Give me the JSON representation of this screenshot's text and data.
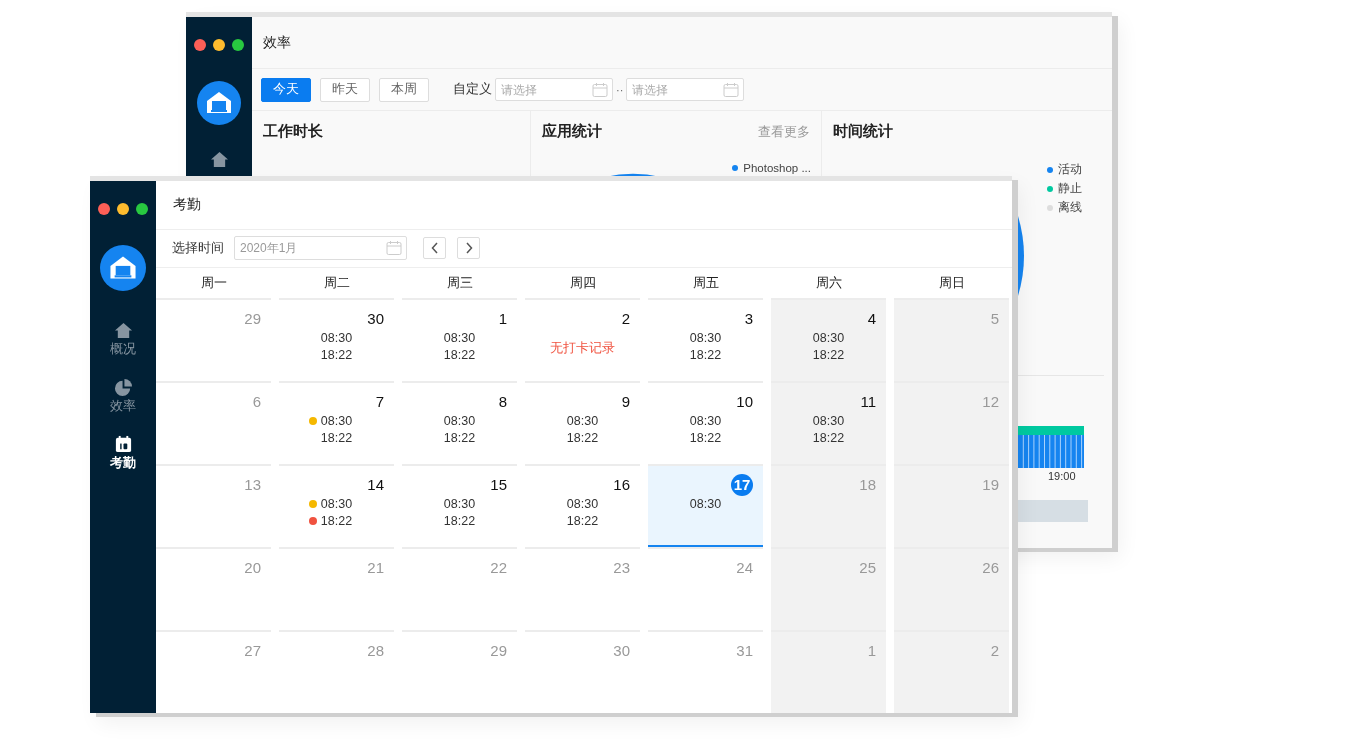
{
  "back_window": {
    "title": "效率",
    "range_buttons": [
      {
        "label": "今天",
        "selected": true
      },
      {
        "label": "昨天",
        "selected": false
      },
      {
        "label": "本周",
        "selected": false
      }
    ],
    "custom_label": "自定义",
    "date_fields": [
      {
        "placeholder": "请选择"
      },
      {
        "placeholder": "请选择"
      }
    ],
    "separator": "··",
    "panels": [
      {
        "kind": "work",
        "title": "工作时长"
      },
      {
        "kind": "apps",
        "title": "应用统计",
        "link": "查看更多",
        "legend": [
          {
            "label": "Photoshop ...",
            "color": "#1584f0"
          }
        ]
      },
      {
        "kind": "time",
        "title": "时间统计",
        "legend": [
          {
            "label": "活动",
            "color": "#1584f0"
          },
          {
            "label": "静止",
            "color": "#00c9a0"
          },
          {
            "label": "离线",
            "color": "#dddddd"
          }
        ],
        "axis_label": "19:00"
      }
    ]
  },
  "front_window": {
    "title": "考勤",
    "sidebar": [
      {
        "kind": "home",
        "label": "概况",
        "selected": false
      },
      {
        "kind": "pie",
        "label": "效率",
        "selected": false
      },
      {
        "kind": "calendar",
        "label": "考勤",
        "selected": true
      }
    ],
    "toolbar": {
      "label": "选择时间",
      "date_value": "2020年1月"
    },
    "weekdays": [
      {
        "label": "周一",
        "weekend": false
      },
      {
        "label": "周二",
        "weekend": false
      },
      {
        "label": "周三",
        "weekend": false
      },
      {
        "label": "周四",
        "weekend": false
      },
      {
        "label": "周五",
        "weekend": false
      },
      {
        "label": "周六",
        "weekend": true
      },
      {
        "label": "周日",
        "weekend": true
      }
    ],
    "weeks": [
      [
        {
          "day": "29",
          "muted": true,
          "selected": false
        },
        {
          "day": "30",
          "muted": false,
          "selected": false,
          "entries": [
            {
              "kind": "time",
              "text": "08:30"
            },
            {
              "kind": "time",
              "text": "18:22"
            }
          ]
        },
        {
          "day": "1",
          "muted": false,
          "selected": false,
          "entries": [
            {
              "kind": "time",
              "text": "08:30"
            },
            {
              "kind": "time",
              "text": "18:22"
            }
          ]
        },
        {
          "day": "2",
          "muted": false,
          "selected": false,
          "entries": [
            {
              "kind": "note",
              "text": "无打卡记录"
            }
          ]
        },
        {
          "day": "3",
          "muted": false,
          "selected": false,
          "entries": [
            {
              "kind": "time",
              "text": "08:30"
            },
            {
              "kind": "time",
              "text": "18:22"
            }
          ]
        },
        {
          "day": "4",
          "muted": false,
          "selected": false,
          "entries": [
            {
              "kind": "time",
              "text": "08:30"
            },
            {
              "kind": "time",
              "text": "18:22"
            }
          ]
        },
        {
          "day": "5",
          "muted": true,
          "selected": false
        }
      ],
      [
        {
          "day": "6",
          "muted": true,
          "selected": false
        },
        {
          "day": "7",
          "muted": false,
          "selected": false,
          "entries": [
            {
              "kind": "time",
              "text": "08:30",
              "color": "#f5b800"
            },
            {
              "kind": "time",
              "text": "18:22"
            }
          ]
        },
        {
          "day": "8",
          "muted": false,
          "selected": false,
          "entries": [
            {
              "kind": "time",
              "text": "08:30"
            },
            {
              "kind": "time",
              "text": "18:22"
            }
          ]
        },
        {
          "day": "9",
          "muted": false,
          "selected": false,
          "entries": [
            {
              "kind": "time",
              "text": "08:30"
            },
            {
              "kind": "time",
              "text": "18:22"
            }
          ]
        },
        {
          "day": "10",
          "muted": false,
          "selected": false,
          "entries": [
            {
              "kind": "time",
              "text": "08:30"
            },
            {
              "kind": "time",
              "text": "18:22"
            }
          ]
        },
        {
          "day": "11",
          "muted": false,
          "selected": false,
          "entries": [
            {
              "kind": "time",
              "text": "08:30"
            },
            {
              "kind": "time",
              "text": "18:22"
            }
          ]
        },
        {
          "day": "12",
          "muted": true,
          "selected": false
        }
      ],
      [
        {
          "day": "13",
          "muted": true,
          "selected": false
        },
        {
          "day": "14",
          "muted": false,
          "selected": false,
          "entries": [
            {
              "kind": "time",
              "text": "08:30",
              "color": "#f5b800"
            },
            {
              "kind": "time",
              "text": "18:22",
              "color": "#f0523f"
            }
          ]
        },
        {
          "day": "15",
          "muted": false,
          "selected": false,
          "entries": [
            {
              "kind": "time",
              "text": "08:30"
            },
            {
              "kind": "time",
              "text": "18:22"
            }
          ]
        },
        {
          "day": "16",
          "muted": false,
          "selected": false,
          "entries": [
            {
              "kind": "time",
              "text": "08:30"
            },
            {
              "kind": "time",
              "text": "18:22"
            }
          ]
        },
        {
          "day": "17",
          "muted": false,
          "selected": true,
          "entries": [
            {
              "kind": "time",
              "text": "08:30"
            }
          ]
        },
        {
          "day": "18",
          "muted": true,
          "selected": false
        },
        {
          "day": "19",
          "muted": true,
          "selected": false
        }
      ],
      [
        {
          "day": "20",
          "muted": true,
          "selected": false
        },
        {
          "day": "21",
          "muted": true,
          "selected": false
        },
        {
          "day": "22",
          "muted": true,
          "selected": false
        },
        {
          "day": "23",
          "muted": true,
          "selected": false
        },
        {
          "day": "24",
          "muted": true,
          "selected": false
        },
        {
          "day": "25",
          "muted": true,
          "selected": false
        },
        {
          "day": "26",
          "muted": true,
          "selected": false
        }
      ],
      [
        {
          "day": "27",
          "muted": true,
          "selected": false
        },
        {
          "day": "28",
          "muted": true,
          "selected": false
        },
        {
          "day": "29",
          "muted": true,
          "selected": false
        },
        {
          "day": "30",
          "muted": true,
          "selected": false
        },
        {
          "day": "31",
          "muted": true,
          "selected": false
        },
        {
          "day": "1",
          "muted": true,
          "selected": false
        },
        {
          "day": "2",
          "muted": true,
          "selected": false
        }
      ]
    ]
  }
}
